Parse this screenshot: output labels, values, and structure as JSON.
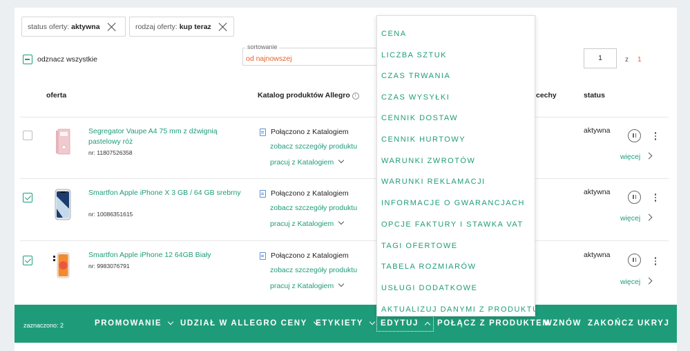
{
  "filters": [
    {
      "label": "status oferty:",
      "value": "aktywna"
    },
    {
      "label": "rodzaj oferty:",
      "value": "kup teraz"
    }
  ],
  "select_all_label": "odznacz wszystkie",
  "sorting": {
    "legend": "sortowanie",
    "value": "od najnowszej"
  },
  "pagination": {
    "current": "1",
    "of": "z",
    "total": "1"
  },
  "columns": {
    "offer": "oferta",
    "catalog": "Katalog produktów Allegro",
    "catalog_info": "i",
    "features": "cechy",
    "status": "status"
  },
  "rows": [
    {
      "checked": false,
      "title": "Segregator Vaupe A4 75 mm z dźwignią pastelowy róż",
      "nr": "nr: 11807526358",
      "catalog_status": "Połączono z Katalogiem",
      "details_link": "zobacz szczegóły produktu",
      "work_link": "pracuj z Katalogiem",
      "status": "aktywna",
      "more": "więcej"
    },
    {
      "checked": true,
      "title": "Smartfon Apple iPhone X 3 GB / 64 GB srebrny",
      "nr": "nr: 10086351615",
      "catalog_status": "Połączono z Katalogiem",
      "details_link": "zobacz szczegóły produktu",
      "work_link": "pracuj z Katalogiem",
      "status": "aktywna",
      "more": "więcej"
    },
    {
      "checked": true,
      "title": "Smartfon Apple iPhone 12 64GB Biały",
      "nr": "nr: 9983076791",
      "catalog_status": "Połączono z Katalogiem",
      "details_link": "zobacz szczegóły produktu",
      "work_link": "pracuj z Katalogiem",
      "status": "aktywna",
      "more": "więcej"
    }
  ],
  "bottom_bar": {
    "selected_count": "zaznaczono: 2",
    "actions": {
      "promote": "PROMOWANIE",
      "allegro_prices": "UDZIAŁ W ALLEGRO CENY",
      "labels": "ETYKIETY",
      "edit": "EDYTUJ",
      "link_product": "POŁĄCZ Z PRODUKTEM",
      "resume": "WZNÓW",
      "end": "ZAKOŃCZ",
      "hide": "UKRYJ"
    }
  },
  "edit_menu": [
    "CENA",
    "LICZBA SZTUK",
    "CZAS TRWANIA",
    "CZAS WYSYŁKI",
    "CENNIK DOSTAW",
    "CENNIK HURTOWY",
    "WARUNKI ZWROTÓW",
    "WARUNKI REKLAMACJI",
    "INFORMACJE O GWARANCJACH",
    "OPCJE FAKTURY I STAWKA VAT",
    "TAGI OFERTOWE",
    "TABELA ROZMIARÓW",
    "USŁUGI DODATKOWE",
    "AKTUALIZUJ DANYMI Z PRODUKTU"
  ],
  "colors": {
    "accent": "#1e9c79",
    "orange": "#e5612a",
    "background": "#eceff1"
  }
}
